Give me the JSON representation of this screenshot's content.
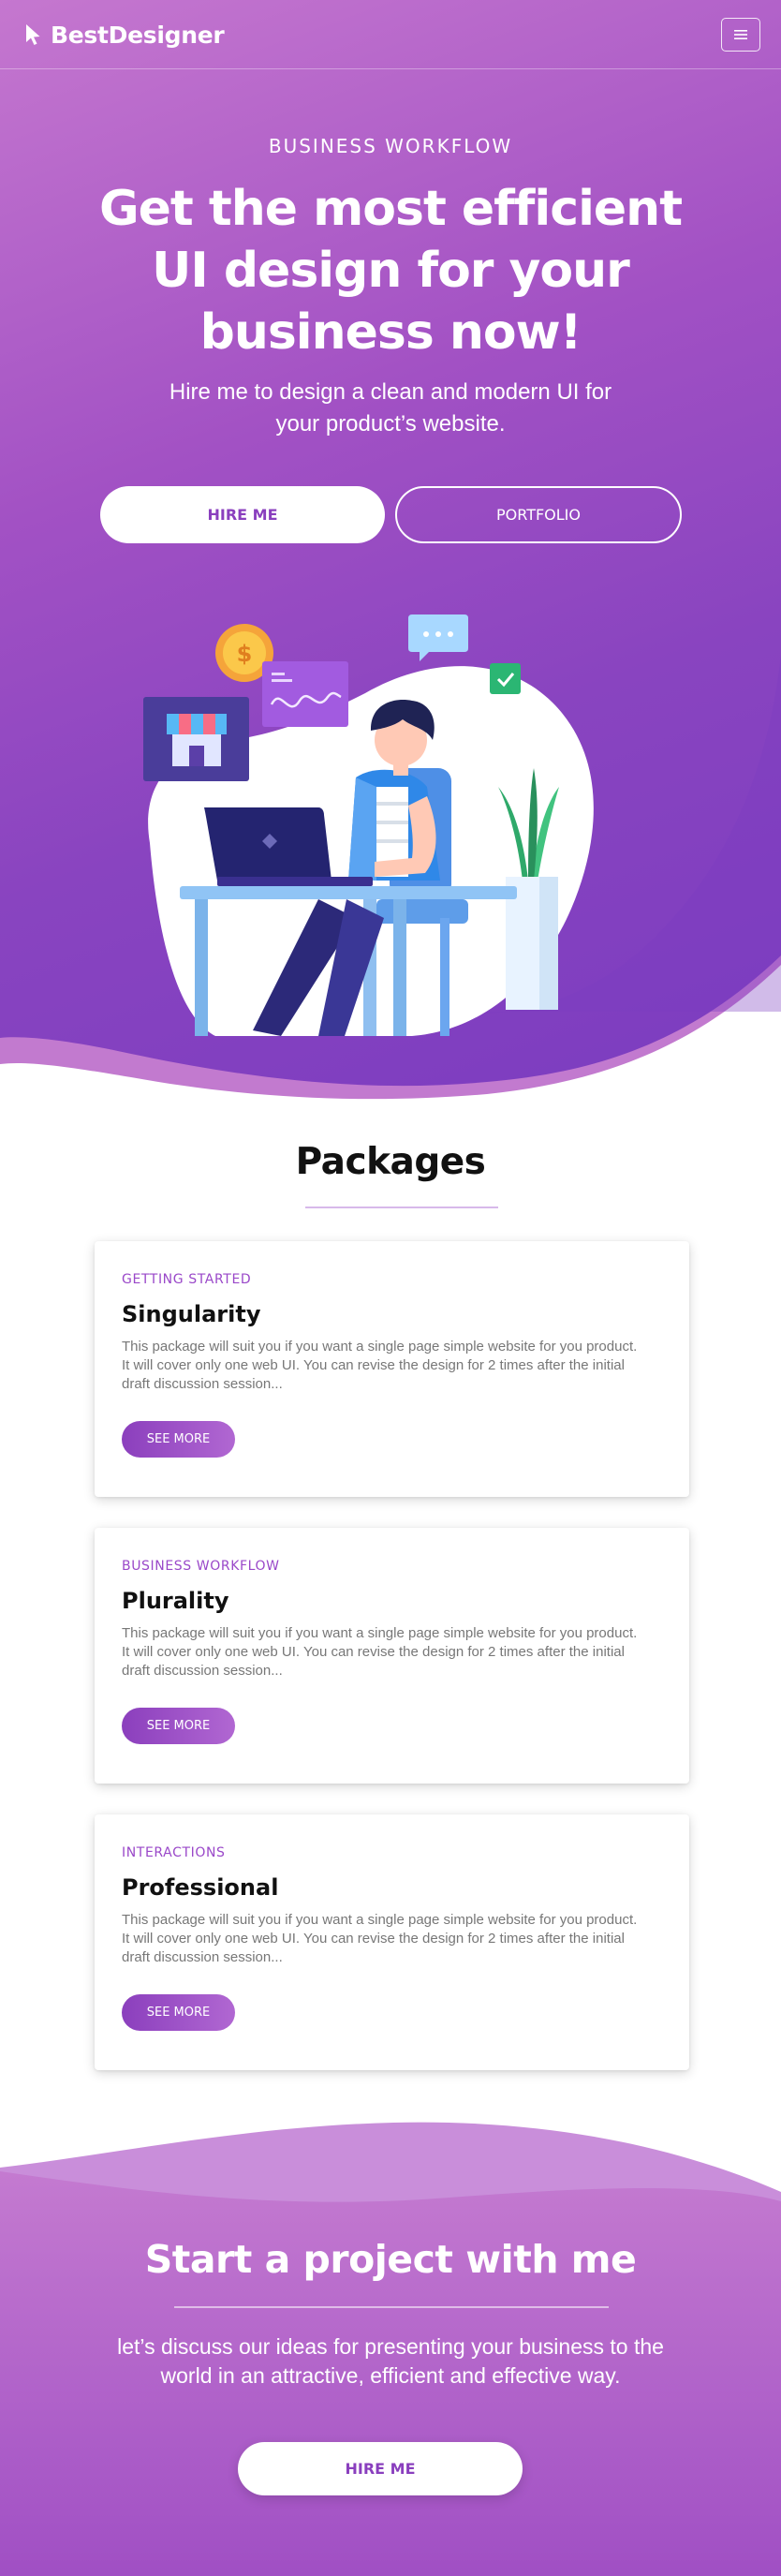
{
  "brand": {
    "name": "BestDesigner",
    "logo_icon": "cursor-arrow-icon"
  },
  "nav": {
    "menu_icon": "hamburger-menu-icon"
  },
  "hero": {
    "eyebrow": "BUSINESS WORKFLOW",
    "headline": "Get the most efficient UI design for your business now!",
    "subline": "Hire me to design a clean and modern UI for your product’s website.",
    "primary_button": "HIRE ME",
    "secondary_button": "PORTFOLIO",
    "illustration_currency": "$"
  },
  "packages": {
    "title": "Packages",
    "items": [
      {
        "tag": "GETTING STARTED",
        "title": "Singularity",
        "description": "This package will suit you if you want a single page  simple website for you product. It  will cover only one web UI.  You can  revise the design for 2 times after  the initial draft  discussion session...",
        "button": "SEE MORE"
      },
      {
        "tag": "BUSINESS WORKFLOW",
        "title": "Plurality",
        "description": "This package will suit you if you want a single page  simple website for you product. It  will cover only one web UI.  You can  revise the design for 2 times after  the initial draft  discussion session...",
        "button": "SEE MORE"
      },
      {
        "tag": "INTERACTIONS",
        "title": "Professional",
        "description": "This package will suit you if you want a single page  simple website for you product. It  will cover only one web UI.  You can  revise the design for 2 times after  the initial draft  discussion session...",
        "button": "SEE MORE"
      }
    ]
  },
  "cta": {
    "title": "Start a project with me",
    "text": "let’s discuss our ideas for presenting your business to the world in an attractive,  efficient and effective way.",
    "button": "HIRE ME"
  },
  "colors": {
    "primary_purple": "#8a3fbe",
    "light_purple": "#c577cf",
    "tag_purple": "#9a48c9",
    "white": "#ffffff"
  }
}
